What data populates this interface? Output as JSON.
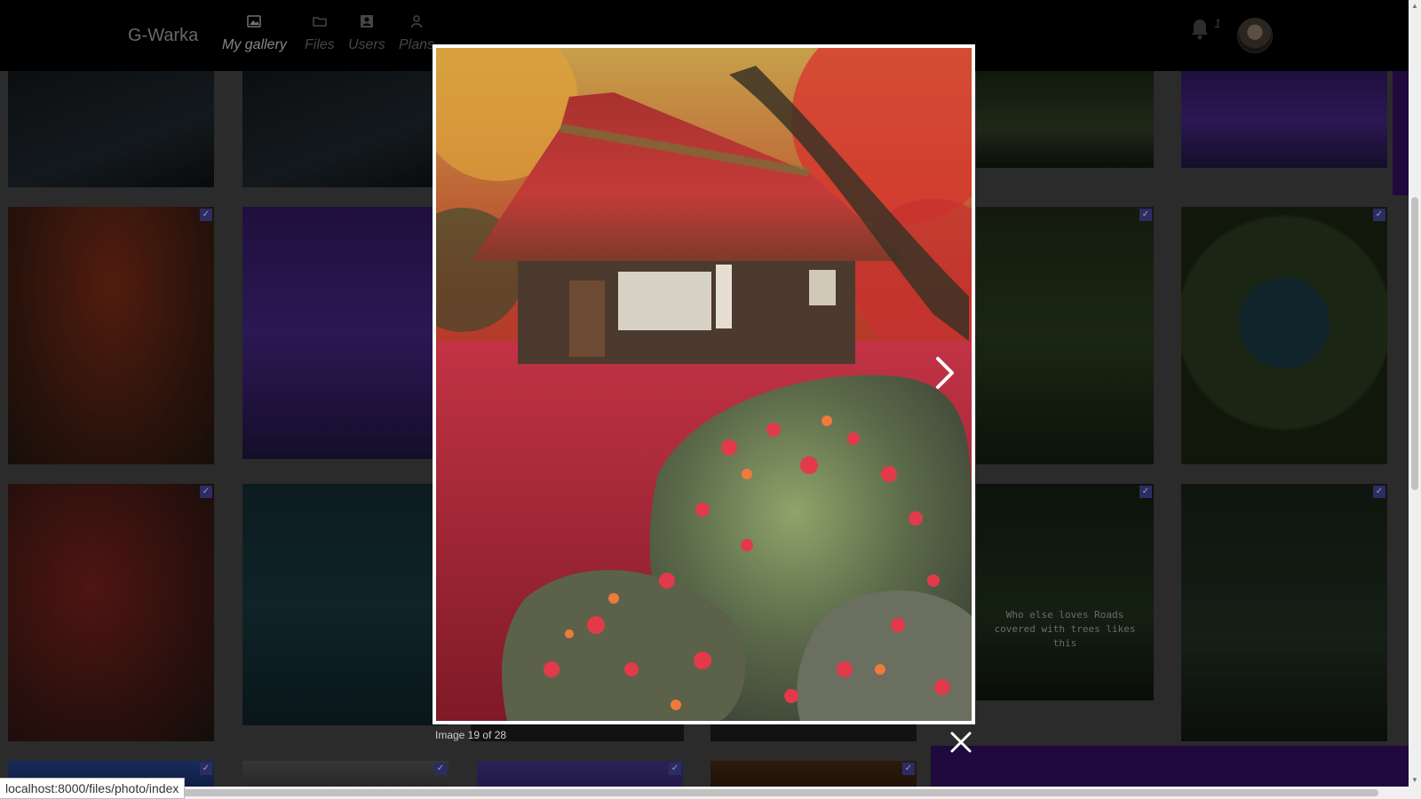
{
  "app": {
    "brand": "G-Warka",
    "nav": [
      {
        "label": "My gallery",
        "icon": "image-icon",
        "active": true
      },
      {
        "label": "Files",
        "icon": "folder-icon",
        "active": false
      },
      {
        "label": "Users",
        "icon": "user-card-icon",
        "active": false
      },
      {
        "label": "Plans",
        "icon": "person-icon",
        "active": false
      }
    ],
    "notification_count": "1"
  },
  "gallery": {
    "tile_caption": "Who else loves Roads covered with trees likes this"
  },
  "lightbox": {
    "caption": "Image 19 of 28",
    "next_label": "Next image",
    "close_label": "Close"
  },
  "status_bar": {
    "url": "localhost:8000/files/photo/index"
  },
  "colors": {
    "navbar_bg": "#000000",
    "accent_purple": "#2a0d52",
    "checkbox": "#3a3c85"
  }
}
